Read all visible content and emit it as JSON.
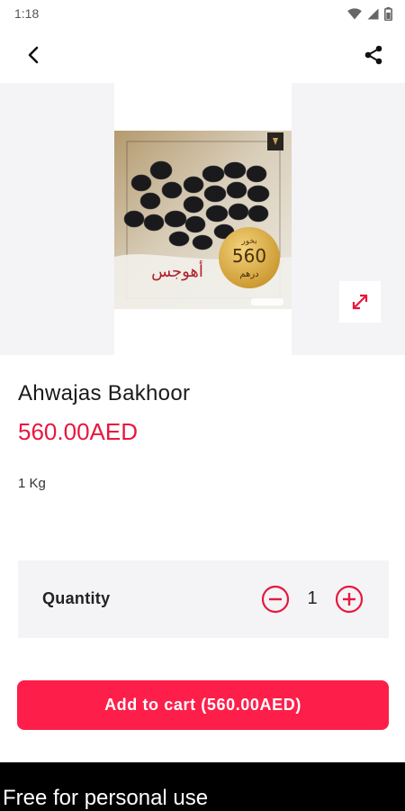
{
  "status_bar": {
    "time": "1:18"
  },
  "product": {
    "title": "Ahwajas Bakhoor",
    "price": "560.00AED",
    "weight": "1 Kg",
    "image_labels": {
      "arabic_name": "أهوجس",
      "price_number": "560",
      "price_unit": "درهم",
      "top_text": "بخور"
    }
  },
  "quantity": {
    "label": "Quantity",
    "value": "1"
  },
  "cart": {
    "button_label": "Add to cart (560.00AED)"
  },
  "watermark": {
    "text": "Free for personal use"
  },
  "colors": {
    "accent": "#e8173e",
    "button": "#fd1f4a",
    "panel": "#f4f4f6"
  },
  "icons": [
    "back-arrow-icon",
    "share-icon",
    "expand-icon",
    "minus-circle-icon",
    "plus-circle-icon",
    "wifi-icon",
    "signal-icon",
    "battery-icon"
  ]
}
